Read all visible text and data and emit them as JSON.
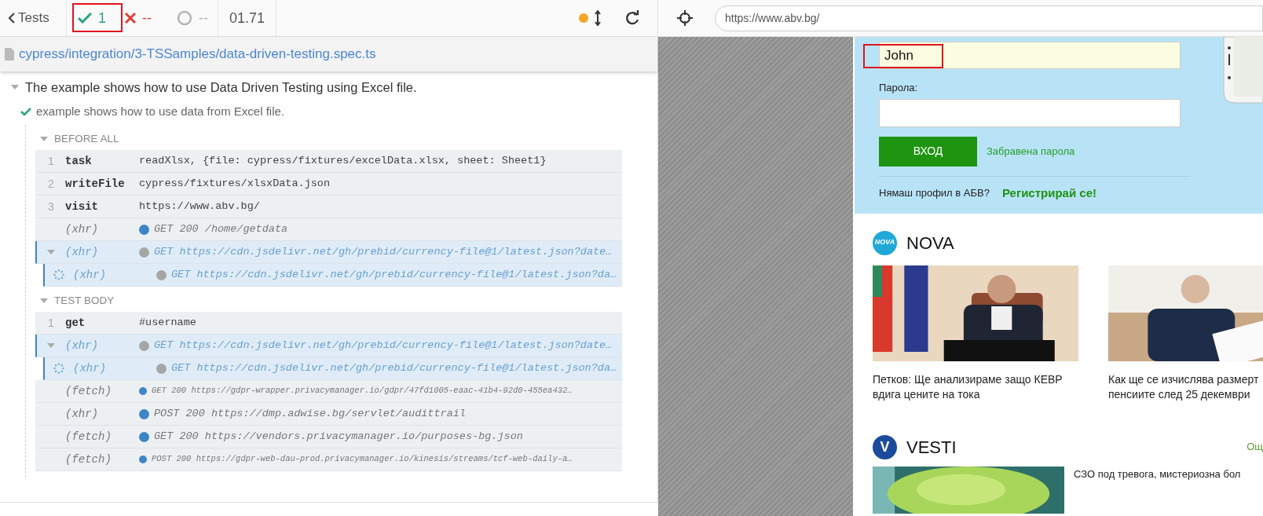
{
  "runner": {
    "back_label": "Tests",
    "passed": "1",
    "failed": "--",
    "pending": "--",
    "duration": "01.71",
    "running": true,
    "passed_highlighted": true
  },
  "spec": {
    "path": "cypress/integration/3-TSSamples/data-driven-testing.spec.ts"
  },
  "suite": {
    "title": "The example shows how to use Data Driven Testing using Excel file.",
    "expanded": true,
    "test": {
      "title": "example shows how to use data from Excel file.",
      "passed": true,
      "hooks": [
        {
          "title": "BEFORE ALL",
          "expanded": true,
          "commands": [
            {
              "kind": "command",
              "number": "1",
              "name": "task",
              "message": "readXlsx, {file: cypress/fixtures/excelData.xlsx, sheet: Sheet1}"
            },
            {
              "kind": "command",
              "number": "2",
              "name": "writeFile",
              "message": "cypress/fixtures/xlsxData.json"
            },
            {
              "kind": "command",
              "number": "3",
              "name": "visit",
              "message": "https://www.abv.bg/"
            },
            {
              "kind": "request",
              "name": "(xhr)",
              "message": "GET 200 /home/getdata",
              "color": "#3d85c6",
              "highlighted": false,
              "compact": false
            },
            {
              "kind": "request",
              "name": "(xhr)",
              "message": "GET https://cdn.jsdelivr.net/gh/prebid/currency-file@1/latest.json?date…",
              "color": "#a6a6a6",
              "highlighted": true,
              "compact": false,
              "expanded": true,
              "children": [
                {
                  "kind": "request",
                  "name": "(xhr)",
                  "message": "GET https://cdn.jsdelivr.net/gh/prebid/currency-file@1/latest.json?da…",
                  "color": "#a6a6a6",
                  "highlighted": true,
                  "compact": false,
                  "pending": true
                }
              ]
            }
          ]
        },
        {
          "title": "TEST BODY",
          "expanded": true,
          "commands": [
            {
              "kind": "command",
              "number": "1",
              "name": "get",
              "message": "#username"
            },
            {
              "kind": "request",
              "name": "(xhr)",
              "message": "GET https://cdn.jsdelivr.net/gh/prebid/currency-file@1/latest.json?date…",
              "color": "#a6a6a6",
              "highlighted": true,
              "compact": false,
              "expanded": true,
              "children": [
                {
                  "kind": "request",
                  "name": "(xhr)",
                  "message": "GET https://cdn.jsdelivr.net/gh/prebid/currency-file@1/latest.json?da…",
                  "color": "#a6a6a6",
                  "highlighted": true,
                  "compact": false,
                  "pending": true
                }
              ]
            },
            {
              "kind": "request",
              "name": "(fetch)",
              "message": "GET 200 https://gdpr-wrapper.privacymanager.io/gdpr/47fd1005-eaac-41b4-92d0-455ea432…",
              "color": "#3d85c6",
              "highlighted": false,
              "compact": true
            },
            {
              "kind": "request",
              "name": "(xhr)",
              "message": "POST 200 https://dmp.adwise.bg/servlet/audittrail",
              "color": "#3d85c6",
              "highlighted": false,
              "compact": false
            },
            {
              "kind": "request",
              "name": "(fetch)",
              "message": "GET 200 https://vendors.privacymanager.io/purposes-bg.json",
              "color": "#3d85c6",
              "highlighted": false,
              "compact": false
            },
            {
              "kind": "request",
              "name": "(fetch)",
              "message": "POST 200 https://gdpr-web-dau-prod.privacymanager.io/kinesis/streams/tcf-web-daily-a…",
              "color": "#3d85c6",
              "highlighted": false,
              "compact": true
            }
          ]
        }
      ]
    }
  },
  "browser": {
    "url": "https://www.abv.bg/"
  },
  "login": {
    "username": "John",
    "username_highlighted": true,
    "password_label": "Парола:",
    "submit": "ВХОД",
    "forgot": "Забравена парола",
    "no_account": "Нямаш профил в АБВ?",
    "register": "Регистрирай се!"
  },
  "news": [
    {
      "logo": "NOVA",
      "source": "NOVA",
      "articles": [
        {
          "kind": "picture",
          "title": "Петков: Ще анализираме защо КЕВР вдига цените на тока"
        },
        {
          "kind": "picture",
          "title": "Как ще се изчислява размерт пенсиите след 25 декември"
        }
      ]
    },
    {
      "logo": "V",
      "source": "VESTI",
      "more": "Ощ",
      "articles": [
        {
          "kind": "picture",
          "title": "СЗО под тревога, мистериозна бол"
        }
      ]
    }
  ]
}
